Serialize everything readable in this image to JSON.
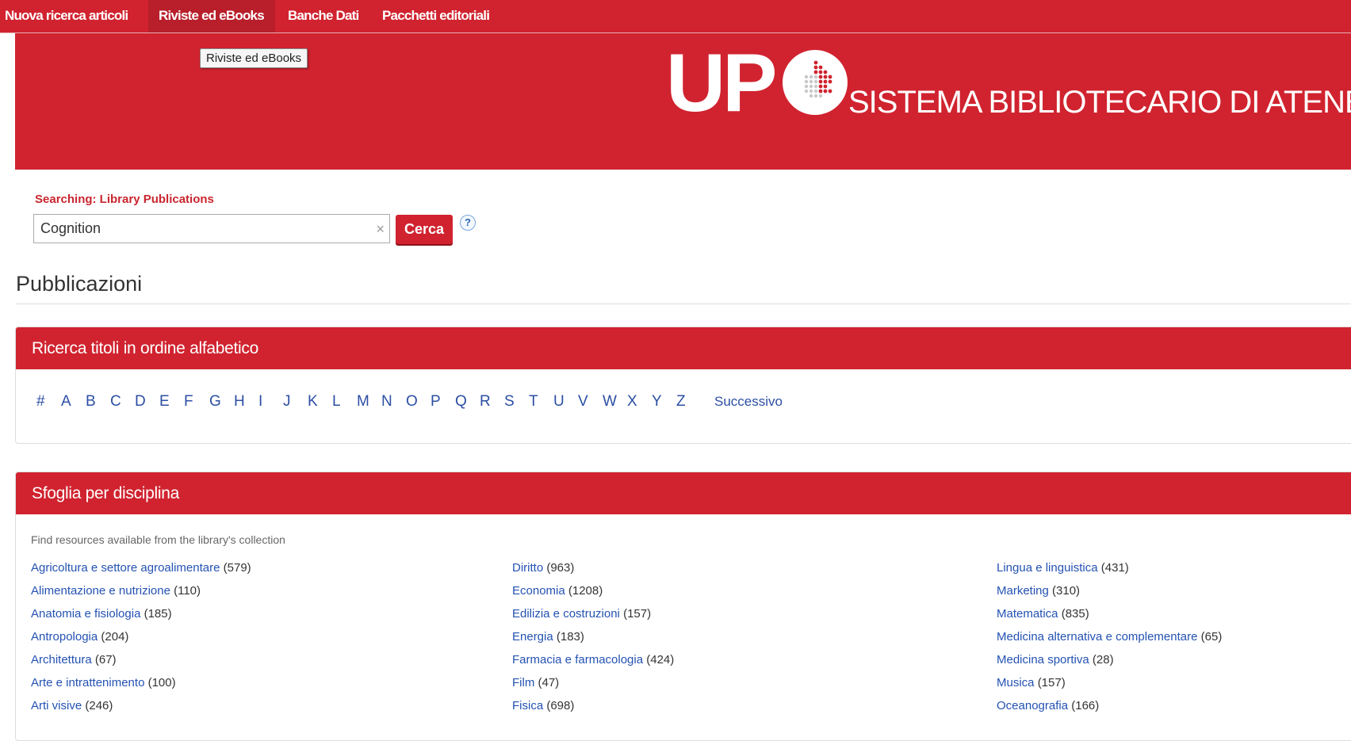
{
  "topnav": {
    "items": [
      {
        "label": "Nuova ricerca articoli"
      },
      {
        "label": "Riviste ed eBooks"
      },
      {
        "label": "Banche Dati"
      },
      {
        "label": "Pacchetti editoriali"
      }
    ],
    "tooltip": "Riviste ed eBooks"
  },
  "banner": {
    "logo_mark": "UP",
    "logo_text": "SISTEMA BIBLIOTECARIO DI ATENEO"
  },
  "search": {
    "label": "Searching: Library Publications",
    "value": "Cognition",
    "button": "Cerca",
    "help": "?",
    "clear": "×"
  },
  "publications": {
    "title": "Pubblicazioni"
  },
  "alphabet_panel": {
    "title": "Ricerca titoli in ordine alfabetico",
    "letters": [
      "#",
      "A",
      "B",
      "C",
      "D",
      "E",
      "F",
      "G",
      "H",
      "I",
      "J",
      "K",
      "L",
      "M",
      "N",
      "O",
      "P",
      "Q",
      "R",
      "S",
      "T",
      "U",
      "V",
      "W",
      "X",
      "Y",
      "Z"
    ],
    "next": "Successivo"
  },
  "discipline_panel": {
    "title": "Sfoglia per disciplina",
    "intro": "Find resources available from the library's collection",
    "columns": [
      [
        {
          "name": "Agricoltura e settore agroalimentare",
          "count": "(579)"
        },
        {
          "name": "Alimentazione e nutrizione",
          "count": "(110)"
        },
        {
          "name": "Anatomia e fisiologia",
          "count": "(185)"
        },
        {
          "name": "Antropologia",
          "count": "(204)"
        },
        {
          "name": "Architettura",
          "count": "(67)"
        },
        {
          "name": "Arte e intrattenimento",
          "count": "(100)"
        },
        {
          "name": "Arti visive",
          "count": "(246)"
        }
      ],
      [
        {
          "name": "Diritto",
          "count": "(963)"
        },
        {
          "name": "Economia",
          "count": "(1208)"
        },
        {
          "name": "Edilizia e costruzioni",
          "count": "(157)"
        },
        {
          "name": "Energia",
          "count": "(183)"
        },
        {
          "name": "Farmacia e farmacologia",
          "count": "(424)"
        },
        {
          "name": "Film",
          "count": "(47)"
        },
        {
          "name": "Fisica",
          "count": "(698)"
        }
      ],
      [
        {
          "name": "Lingua e linguistica",
          "count": "(431)"
        },
        {
          "name": "Marketing",
          "count": "(310)"
        },
        {
          "name": "Matematica",
          "count": "(835)"
        },
        {
          "name": "Medicina alternativa e complementare",
          "count": "(65)"
        },
        {
          "name": "Medicina sportiva",
          "count": "(28)"
        },
        {
          "name": "Musica",
          "count": "(157)"
        },
        {
          "name": "Oceanografia",
          "count": "(166)"
        }
      ]
    ]
  }
}
